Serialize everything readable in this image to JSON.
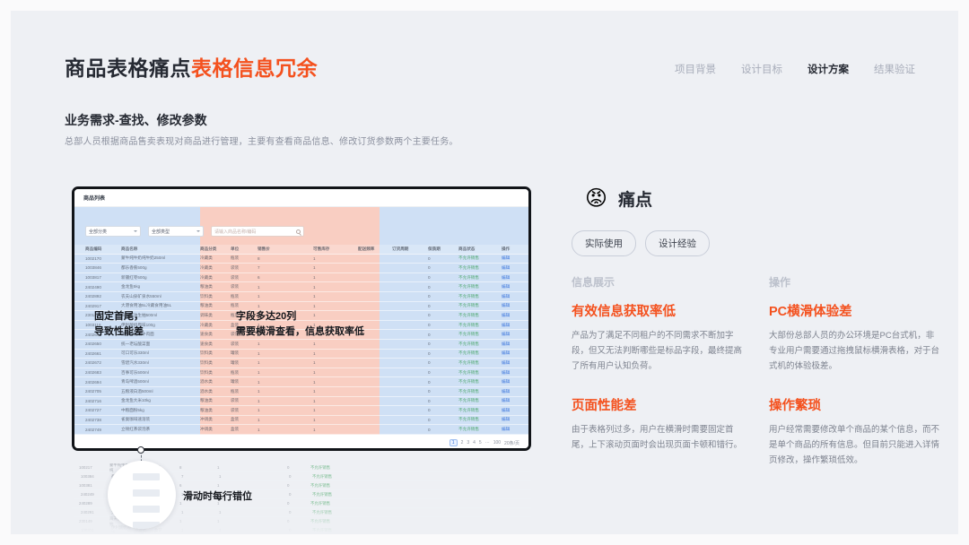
{
  "header": {
    "title_main": "商品表格痛点",
    "title_accent": "表格信息冗余",
    "nav": [
      {
        "label": "项目背景",
        "active": false
      },
      {
        "label": "设计目标",
        "active": false
      },
      {
        "label": "设计方案",
        "active": true
      },
      {
        "label": "结果验证",
        "active": false
      }
    ]
  },
  "section": {
    "title": "业务需求-查找、修改参数",
    "desc": "总部人员根据商品售卖表现对商品进行管理，主要有查看商品信息、修改订货参数两个主要任务。"
  },
  "screenshot": {
    "window_title": "商品列表",
    "filters": {
      "category": "全部分类",
      "type": "全部类型",
      "search_placeholder": "请输入商品名称/编码"
    },
    "table": {
      "headers": [
        "商品编码",
        "商品名称",
        "商品分类",
        "单位",
        "销售价",
        "可售库存",
        "配送频率",
        "订货周期",
        "保质期",
        "商品状态",
        "操作"
      ],
      "rows": [
        [
          "1002170",
          "蒙牛纯牛奶纯牛奶250ml",
          "冷藏类",
          "瓶装",
          "8",
          "1",
          "",
          "",
          "0",
          "不允许销售",
          "编辑"
        ],
        [
          "1003846",
          "都乐香蕉500g",
          "冷藏类",
          "袋装",
          "7",
          "1",
          "",
          "",
          "0",
          "不允许销售",
          "编辑"
        ],
        [
          "1003817",
          "新疆红枣500g",
          "冷藏类",
          "袋装",
          "6",
          "1",
          "",
          "",
          "0",
          "不允许销售",
          "编辑"
        ],
        [
          "2402490",
          "金龙鱼5kg",
          "粮油类",
          "袋装",
          "1",
          "1",
          "",
          "",
          "0",
          "不允许销售",
          "编辑"
        ],
        [
          "2402892",
          "农夫山泉矿泉水550ml",
          "饮料类",
          "瓶装",
          "1",
          "1",
          "",
          "",
          "0",
          "不允许销售",
          "编辑"
        ],
        [
          "2402917",
          "大港食用油5L冷藏食用油5L",
          "粮油类",
          "瓶装",
          "1",
          "1",
          "",
          "",
          "0",
          "不允许销售",
          "编辑"
        ],
        [
          "2301499",
          "海天酱油生抽500ml",
          "调味类",
          "瓶装",
          "1",
          "1",
          "",
          "",
          "0",
          "不允许销售",
          "编辑"
        ],
        [
          "1003116",
          "伊利酸奶原味100g",
          "冷藏类",
          "盒装",
          "1",
          "1",
          "",
          "",
          "0",
          "不允许销售",
          "编辑"
        ],
        [
          "2402641",
          "康师傅红烧牛肉面",
          "速食类",
          "袋装",
          "1",
          "1",
          "",
          "",
          "0",
          "不允许销售",
          "编辑"
        ],
        [
          "2402650",
          "统一老坛酸菜面",
          "速食类",
          "袋装",
          "1",
          "1",
          "",
          "",
          "0",
          "不允许销售",
          "编辑"
        ],
        [
          "2402661",
          "可口可乐330ml",
          "饮料类",
          "罐装",
          "1",
          "1",
          "",
          "",
          "0",
          "不允许销售",
          "编辑"
        ],
        [
          "2402672",
          "雪碧汽水330ml",
          "饮料类",
          "罐装",
          "1",
          "1",
          "",
          "",
          "0",
          "不允许销售",
          "编辑"
        ],
        [
          "2402683",
          "百事可乐500ml",
          "饮料类",
          "瓶装",
          "1",
          "1",
          "",
          "",
          "0",
          "不允许销售",
          "编辑"
        ],
        [
          "2402694",
          "青岛啤酒500ml",
          "酒水类",
          "罐装",
          "1",
          "1",
          "",
          "",
          "0",
          "不允许销售",
          "编辑"
        ],
        [
          "2402705",
          "五粮液白酒500ml",
          "酒水类",
          "瓶装",
          "1",
          "1",
          "",
          "",
          "0",
          "不允许销售",
          "编辑"
        ],
        [
          "2402716",
          "金龙鱼大米10kg",
          "粮油类",
          "袋装",
          "1",
          "1",
          "",
          "",
          "0",
          "不允许销售",
          "编辑"
        ],
        [
          "2402727",
          "中粮面粉5kg",
          "粮油类",
          "袋装",
          "1",
          "1",
          "",
          "",
          "0",
          "不允许销售",
          "编辑"
        ],
        [
          "2402738",
          "雀巢咖啡速溶装",
          "冲调类",
          "盒装",
          "1",
          "1",
          "",
          "",
          "0",
          "不允许销售",
          "编辑"
        ],
        [
          "2402749",
          "立顿红茶袋泡茶",
          "冲调类",
          "盒装",
          "1",
          "1",
          "",
          "",
          "0",
          "不允许销售",
          "编辑"
        ],
        [
          "2402760",
          "德芙巧克力排块",
          "零食类",
          "盒装",
          "1",
          "1",
          "",
          "",
          "0",
          "不允许销售",
          "编辑"
        ]
      ]
    },
    "pagination": {
      "pages": [
        "1",
        "2",
        "3",
        "4",
        "5",
        "···",
        "100"
      ],
      "current": "1",
      "page_size": "20条/页"
    },
    "annotations": {
      "left_line1": "固定首尾，",
      "left_line2": "导致性能差",
      "mid_line1": "字段多达20列",
      "mid_line2": "需要横滑查看，信息获取率低",
      "bottom": "滑动时每行错位"
    }
  },
  "pain": {
    "emoji": "😡",
    "emoji_name": "angry-face-emoji",
    "title": "痛点",
    "tags": [
      "实际使用",
      "设计经验"
    ],
    "columns": [
      {
        "label": "信息展示",
        "items": [
          {
            "title": "有效信息获取率低",
            "body": "产品为了满足不同租户的不同需求不断加字段，但又无法判断哪些是标品字段，最终提高了所有用户认知负荷。"
          },
          {
            "title": "页面性能差",
            "body": "由于表格列过多，用户在横滑时需要固定首尾，上下滚动页面时会出现页面卡顿和错行。"
          }
        ]
      },
      {
        "label": "操作",
        "items": [
          {
            "title": "PC横滑体验差",
            "body": "大部份总部人员的办公环境是PC台式机，非专业用户需要通过拖拽鼠标横滑表格，对于台式机的体验极差。"
          },
          {
            "title": "操作繁琐",
            "body": "用户经常需要修改单个商品的某个信息，而不是单个商品的所有信息。但目前只能进入详情页修改，操作繁琐低效。"
          }
        ]
      }
    ]
  },
  "colors": {
    "accent": "#f4511e",
    "ink": "#262a33",
    "muted": "#8b909e",
    "band_blue": "#cfe0f5",
    "band_pink": "#f9cec2",
    "status_green": "#3aa05a",
    "link_blue": "#2f6ddb"
  }
}
